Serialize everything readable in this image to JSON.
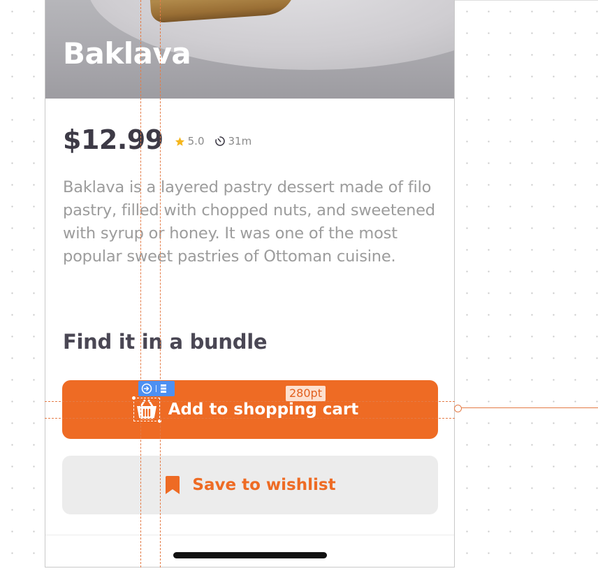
{
  "product": {
    "name": "Baklava",
    "price": "$12.99",
    "rating": "5.0",
    "time": "31m",
    "description": "Baklava is a layered pastry dessert made of filo pastry, filled with chopped nuts, and sweetened with syrup or honey. It was one of the most popular sweet pastries of Ottoman cuisine."
  },
  "bundle": {
    "title": "Find it in a bundle"
  },
  "actions": {
    "add_to_cart": "Add to shopping cart",
    "save_to_wishlist": "Save to wishlist"
  },
  "design_overlay": {
    "measurement_label": "280pt"
  },
  "colors": {
    "accent": "#ee6b24",
    "star": "#f5b61c",
    "title": "#3d3a46",
    "body_text": "#9c9c9c",
    "secondary_button_bg": "#ececec",
    "selection_toolbar": "#4d90f2"
  },
  "icons": {
    "rating": "star-icon",
    "time": "timer-icon",
    "cart": "basket-icon",
    "wishlist": "bookmark-icon"
  }
}
